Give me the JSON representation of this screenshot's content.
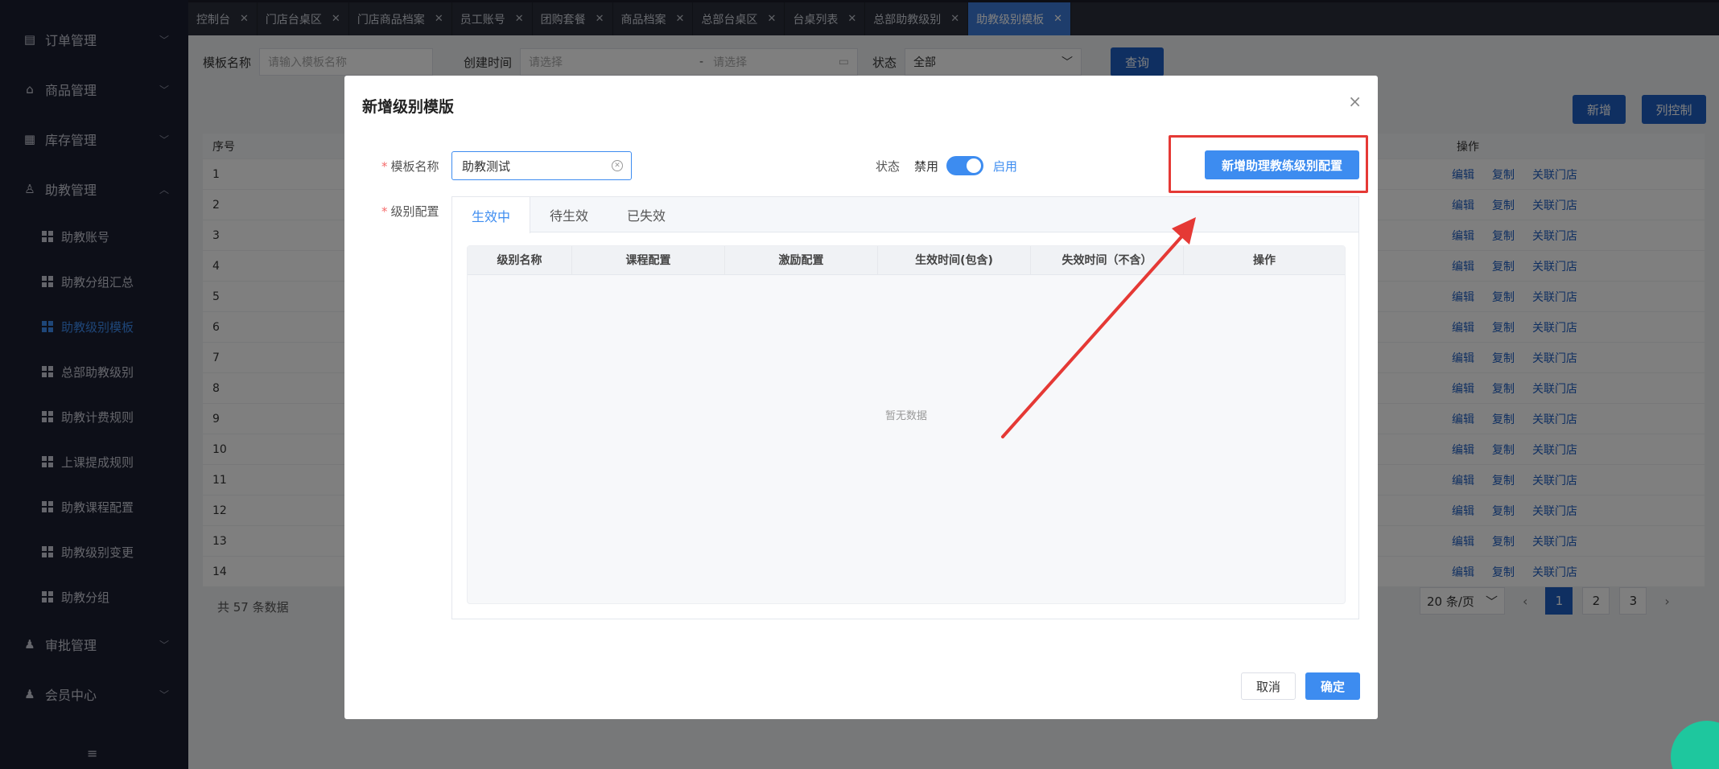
{
  "sidebar": {
    "menus": [
      {
        "label": "订单管理",
        "icon": "document-icon",
        "glyph": "▤",
        "chev": "﹀"
      },
      {
        "label": "商品管理",
        "icon": "bag-icon",
        "glyph": "⌂",
        "chev": "﹀"
      },
      {
        "label": "库存管理",
        "icon": "inventory-icon",
        "glyph": "▦",
        "chev": "﹀"
      },
      {
        "label": "助教管理",
        "icon": "user-icon",
        "glyph": "♙",
        "chev": "︿"
      }
    ],
    "sub_items": [
      "助教账号",
      "助教分组汇总",
      "助教级别模板",
      "总部助教级别",
      "助教计费规则",
      "上课提成规则",
      "助教课程配置",
      "助教级别变更",
      "助教分组"
    ],
    "menus_after": [
      {
        "label": "审批管理",
        "icon": "approval-icon",
        "glyph": "♟",
        "chev": "﹀"
      },
      {
        "label": "会员中心",
        "icon": "member-icon",
        "glyph": "♟",
        "chev": "﹀"
      }
    ],
    "toggle_glyph": "≡"
  },
  "tabs": [
    "控制台",
    "门店台桌区",
    "门店商品档案",
    "员工账号",
    "团购套餐",
    "商品档案",
    "总部台桌区",
    "台桌列表",
    "总部助教级别",
    "助教级别模板"
  ],
  "tab_close": "✕",
  "filters": {
    "template_name_label": "模板名称",
    "template_name_placeholder": "请输入模板名称",
    "created_label": "创建时间",
    "date_start": "请选择",
    "date_sep": "-",
    "date_end": "请选择",
    "status_label": "状态",
    "status_value": "全部",
    "query_button": "查询"
  },
  "toolbar": {
    "add": "新增",
    "columns": "列控制"
  },
  "bg_table": {
    "seq_header": "序号",
    "ops_header": "操作",
    "rows": [
      "1",
      "2",
      "3",
      "4",
      "5",
      "6",
      "7",
      "8",
      "9",
      "10",
      "11",
      "12",
      "13",
      "14"
    ],
    "ops": [
      "编辑",
      "复制",
      "关联门店"
    ]
  },
  "bg_footer": {
    "total": "共 57 条数据",
    "page_size": "20 条/页",
    "pages": [
      "1",
      "2",
      "3"
    ],
    "prev": "‹",
    "next": "›"
  },
  "dialog": {
    "title": "新增级别模版",
    "close": "×",
    "template_name_label": "模板名称",
    "template_name_value": "助教测试",
    "status_label": "状态",
    "status_off": "禁用",
    "status_on": "启用",
    "status_enabled": true,
    "add_config_button": "新增助理教练级别配置",
    "level_config_label": "级别配置",
    "level_tabs": [
      "生效中",
      "待生效",
      "已失效"
    ],
    "columns": [
      "级别名称",
      "课程配置",
      "激励配置",
      "生效时间(包含)",
      "失效时间（不含）",
      "操作"
    ],
    "empty_text": "暂无数据",
    "cancel": "取消",
    "ok": "确定"
  },
  "colors": {
    "primary": "#3d8cf0",
    "annotation": "#e53935",
    "sidebar_bg": "#1b1e30"
  }
}
